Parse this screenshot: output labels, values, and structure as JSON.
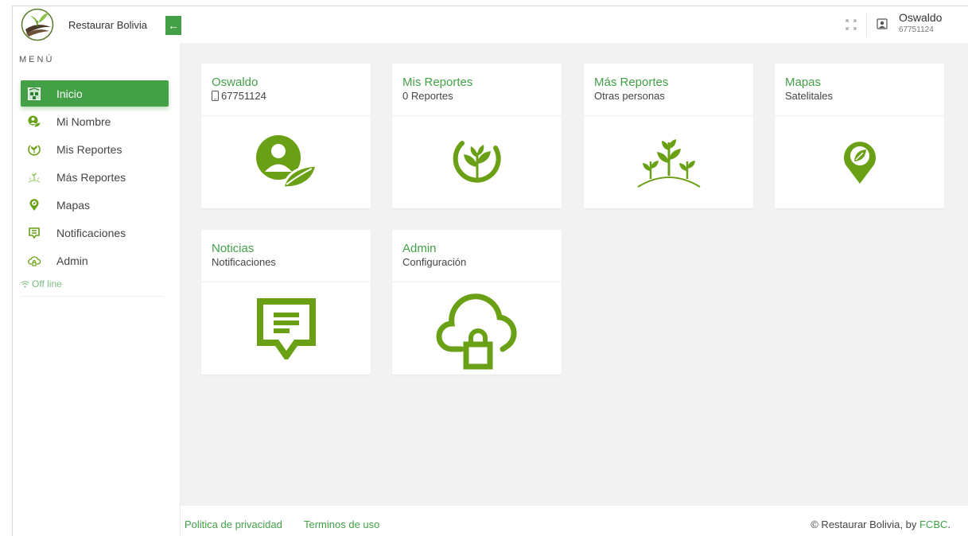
{
  "brand": {
    "name": "Restaurar Bolivia",
    "logo_icon": "plant-logo-icon"
  },
  "header": {
    "collapse_icon": "arrow-left-icon",
    "fullscreen_icon": "expand-icon",
    "user_icon": "user-icon",
    "user_name": "Oswaldo",
    "user_phone": "67751124"
  },
  "colors": {
    "accent": "#43a047",
    "icon_green": "#6aa016",
    "background": "#f2f2f2"
  },
  "sidebar": {
    "title": "MENÚ",
    "items": [
      {
        "label": "Inicio",
        "icon": "home-icon",
        "active": true
      },
      {
        "label": "Mi Nombre",
        "icon": "user-leaf-icon"
      },
      {
        "label": "Mis Reportes",
        "icon": "plant-report-icon"
      },
      {
        "label": "Más Reportes",
        "icon": "plants-icon"
      },
      {
        "label": "Mapas",
        "icon": "map-pin-icon"
      },
      {
        "label": "Notificaciones",
        "icon": "message-icon"
      },
      {
        "label": "Admin",
        "icon": "cloud-lock-icon"
      }
    ],
    "status": "Off line",
    "status_icon": "wifi-icon"
  },
  "cards": [
    {
      "title": "Oswaldo",
      "subtitle": "67751124",
      "icon": "user-leaf-icon"
    },
    {
      "title": "Mis Reportes",
      "subtitle": "0 Reportes",
      "icon": "plant-report-icon"
    },
    {
      "title": "Más Reportes",
      "subtitle": "Otras personas",
      "icon": "plants-icon"
    },
    {
      "title": "Mapas",
      "subtitle": "Satelitales",
      "icon": "map-pin-icon"
    },
    {
      "title": "Noticias",
      "subtitle": "Notificaciones",
      "icon": "message-icon"
    },
    {
      "title": "Admin",
      "subtitle": "Configuración",
      "icon": "cloud-lock-icon"
    }
  ],
  "footer": {
    "privacy": "Politica de privacidad",
    "terms": "Terminos de uso",
    "copyright_prefix": "© Restaurar Bolivia, by ",
    "copyright_link": "FCBC",
    "copyright_suffix": "."
  }
}
